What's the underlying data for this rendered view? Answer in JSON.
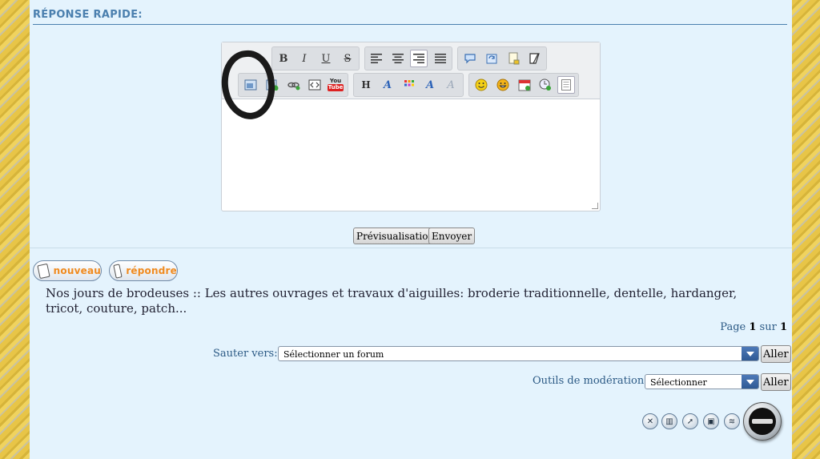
{
  "section": {
    "title": "RÉPONSE RAPIDE:"
  },
  "editor": {
    "toolbar": {
      "row1": [
        "bold-icon",
        "italic-icon",
        "underline-icon",
        "strikethrough-icon",
        "align-left-icon",
        "align-center-icon",
        "align-right-icon",
        "align-justify-icon",
        "quote-icon",
        "refresh-icon",
        "note-icon",
        "eraser-icon"
      ],
      "row2": [
        "image-icon",
        "image-upload-icon",
        "link-icon",
        "code-icon",
        "youtube-icon",
        "heading-icon",
        "font-icon",
        "color-icon",
        "font-style-icon",
        "remove-format-icon",
        "smiley-icon",
        "emoji-icon",
        "date-icon",
        "time-icon",
        "source-icon"
      ],
      "glyphs": {
        "bold": "B",
        "italic": "I",
        "underline": "U",
        "strike": "S",
        "heading": "H",
        "font": "A",
        "font_style": "A",
        "remove_format": "A",
        "youtube_top": "You",
        "youtube_bottom": "Tube"
      }
    },
    "body_text": ""
  },
  "buttons": {
    "preview": "Prévisualisation",
    "send": "Envoyer"
  },
  "actions": {
    "new": "nouveau",
    "reply": "répondre"
  },
  "breadcrumb": "Nos jours de brodeuses :: Les autres ouvrages et travaux d'aiguilles: broderie traditionnelle, dentelle, hardanger, tricot, couture, patch...",
  "pagination": {
    "prefix": "Page",
    "current": "1",
    "sep": "sur",
    "total": "1"
  },
  "jump": {
    "label": "Sauter vers:",
    "value": "Sélectionner un forum",
    "go": "Aller"
  },
  "moderation": {
    "label": "Outils de modération:",
    "value": "Sélectionner",
    "go": "Aller",
    "icons": [
      "delete-icon",
      "trash-icon",
      "move-icon",
      "lock-icon",
      "split-icon"
    ]
  },
  "colors": {
    "accent": "#4a7fae",
    "panel_bg": "#e4f3fd",
    "action_text": "#f08a1e",
    "select_arrow": "#2f5a94"
  }
}
